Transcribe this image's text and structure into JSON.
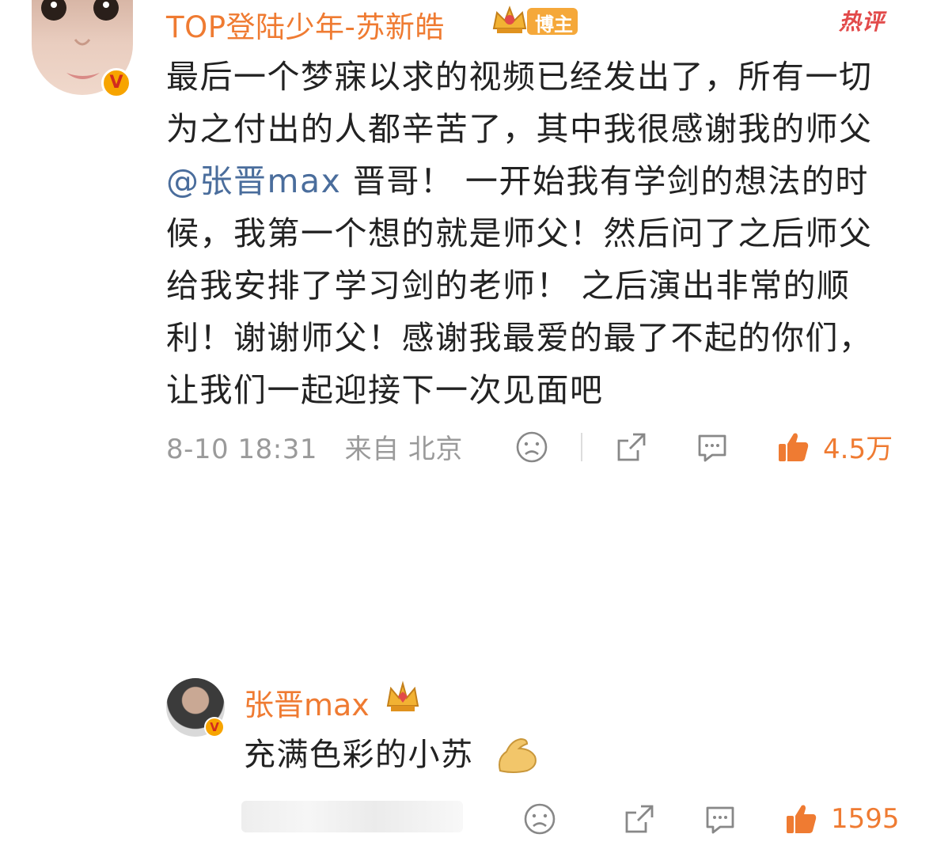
{
  "main_comment": {
    "username": "TOP登陆少年-苏新皓",
    "badge_label": "博主",
    "hot_tag": "热评",
    "text_before_mention": "最后一个梦寐以求的视频已经发出了，所有一切为之付出的人都辛苦了，其中我很感谢我的师父 ",
    "mention": "@张晋max",
    "text_after_mention": " 晋哥！ 一开始我有学剑的想法的时候，我第一个想的就是师父！然后问了之后师父给我安排了学习剑的老师！ 之后演出非常的顺利！谢谢师父！感谢我最爱的最了不起的你们， 让我们一起迎接下一次见面吧",
    "timestamp": "8-10 18:31",
    "location": "来自 北京",
    "like_count": "4.5万",
    "verified_mark": "V"
  },
  "reply": {
    "username": "张晋max",
    "text": "充满色彩的小苏",
    "like_count": "1595",
    "verified_mark": "V"
  },
  "icons": {
    "dislike": "sad-face-icon",
    "share": "share-icon",
    "comment": "comment-bubble-icon",
    "like": "thumbs-up-icon",
    "crown": "crown-badge-icon",
    "emoji": "flexed-biceps-emoji-icon"
  },
  "colors": {
    "accent": "#ef7b32",
    "mention": "#4a6d9c",
    "meta_gray": "#9a9a9a",
    "hot": "#e24a4a"
  }
}
